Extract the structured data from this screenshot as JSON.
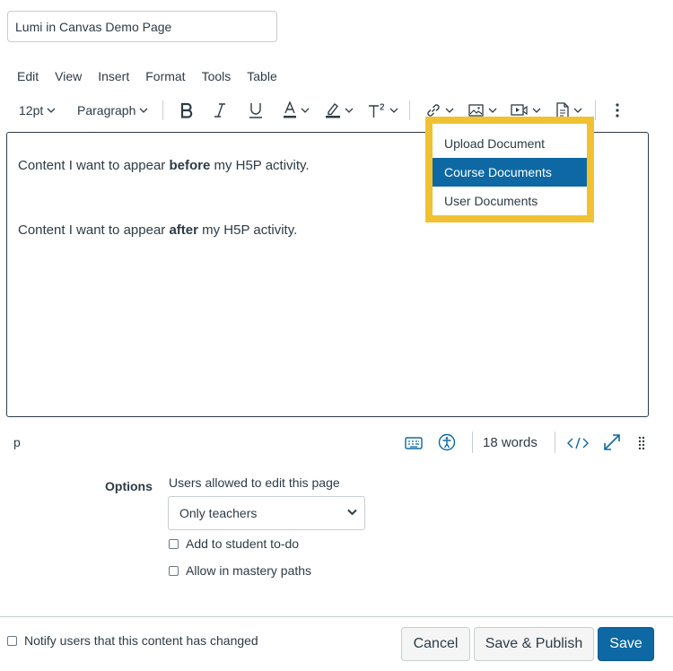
{
  "page_title_input": {
    "value": "Lumi in Canvas Demo Page"
  },
  "menubar": {
    "items": [
      "Edit",
      "View",
      "Insert",
      "Format",
      "Tools",
      "Table"
    ]
  },
  "toolbar": {
    "font_size": "12pt",
    "block_format": "Paragraph",
    "icons": [
      "bold-icon",
      "italic-icon",
      "underline-icon",
      "text-color-icon",
      "highlight-icon",
      "superscript-icon",
      "link-icon",
      "image-icon",
      "media-icon",
      "document-icon",
      "more-icon"
    ]
  },
  "editor": {
    "line1": {
      "before": "Content I want to appear ",
      "bold": "before",
      "after": " my H5P activity."
    },
    "line2": {
      "before": "Content I want to appear ",
      "bold": "after",
      "after": " my H5P activity."
    }
  },
  "document_menu": {
    "items": [
      "Upload Document",
      "Course Documents",
      "User Documents"
    ],
    "active_index": 1,
    "highlight_color": "#f0c233"
  },
  "statusbar": {
    "element_path": "p",
    "word_count": "18 words",
    "icons": [
      "keyboard-icon",
      "accessibility-icon",
      "html-code-icon",
      "fullscreen-icon",
      "resize-handle-icon"
    ]
  },
  "options": {
    "label": "Options",
    "users_label": "Users allowed to edit this page",
    "selected": "Only teachers",
    "checkbox_todo": "Add to student to-do",
    "checkbox_mastery": "Allow in mastery paths"
  },
  "footer": {
    "notify_label": "Notify users that this content has changed",
    "cancel": "Cancel",
    "save_publish": "Save & Publish",
    "save": "Save"
  },
  "colors": {
    "primary": "#0e68a3",
    "text": "#2d3b45",
    "border": "#c7cdd1"
  }
}
